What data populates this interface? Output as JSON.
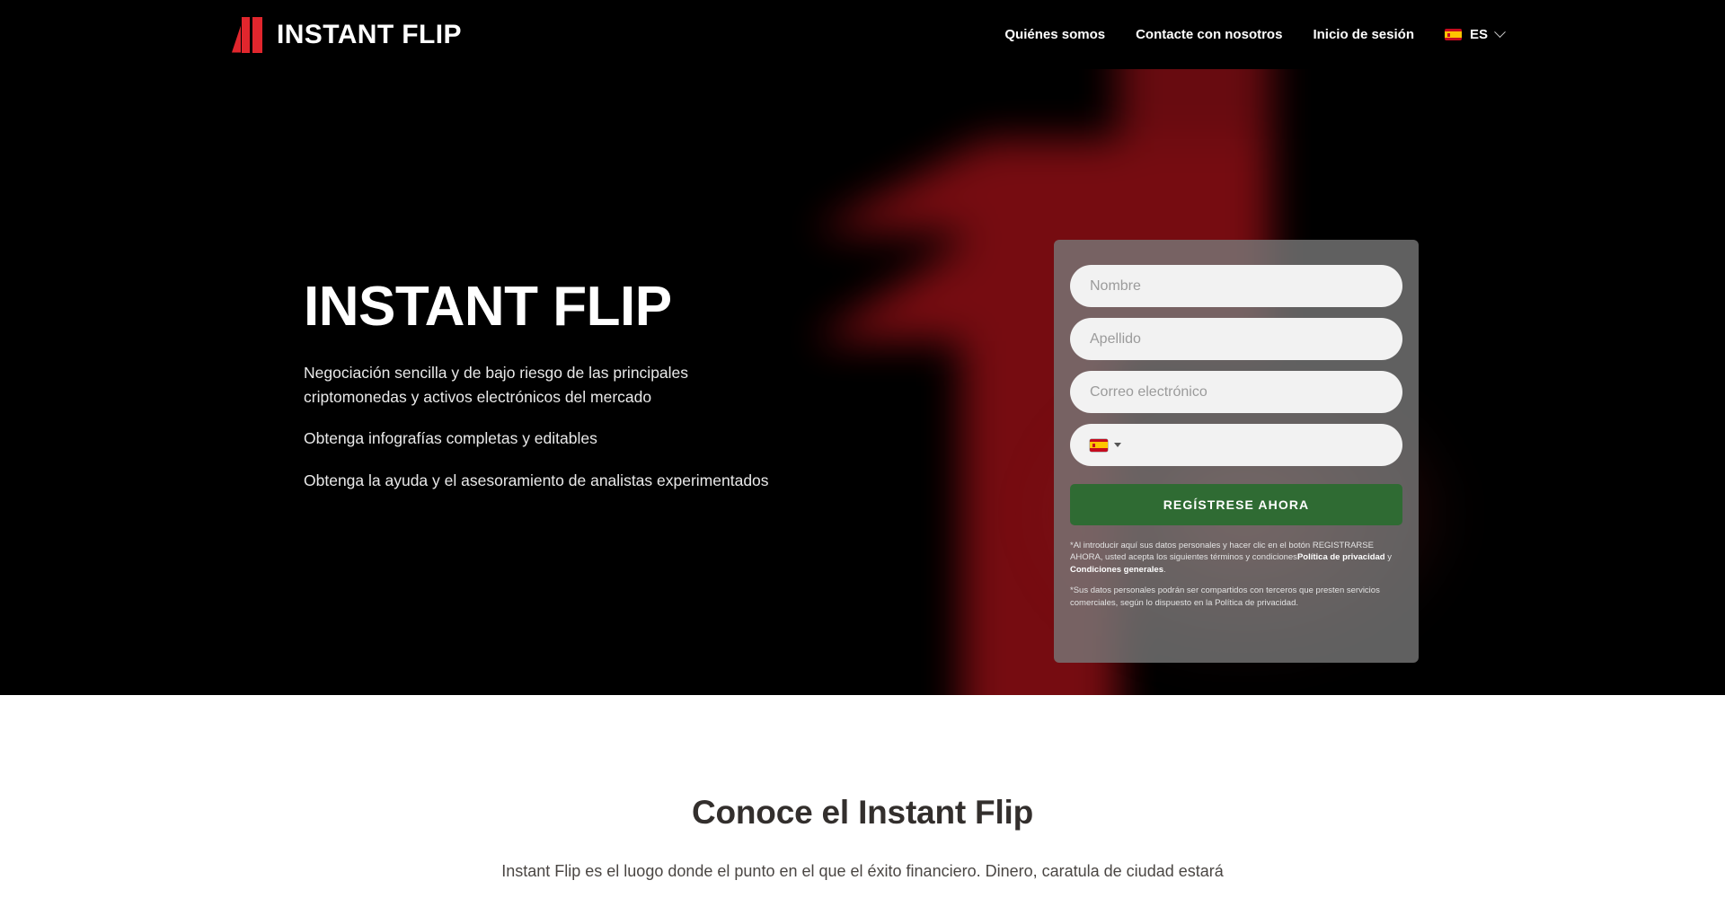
{
  "header": {
    "brand_name": "INSTANT FLIP",
    "logo_icon": "instant-flip-bars-logo",
    "nav": [
      {
        "label": "Quiénes somos"
      },
      {
        "label": "Contacte con nosotros"
      },
      {
        "label": "Inicio de sesión"
      }
    ],
    "language": {
      "code": "ES",
      "flag_icon": "spain-flag-icon",
      "chevron_icon": "chevron-down-icon"
    }
  },
  "hero": {
    "title": "INSTANT FLIP",
    "paragraphs": [
      "Negociación sencilla y de bajo riesgo de las principales criptomonedas y activos electrónicos del mercado",
      "Obtenga infografías completas y editables",
      "Obtenga la ayuda y el asesoramiento de analistas experimentados"
    ],
    "background_icon": "red-up-arrow-graphic"
  },
  "signup": {
    "fields": [
      {
        "name": "first-name",
        "placeholder": "Nombre",
        "value": ""
      },
      {
        "name": "last-name",
        "placeholder": "Apellido",
        "value": ""
      },
      {
        "name": "email",
        "placeholder": "Correo electrónico",
        "value": ""
      }
    ],
    "phone": {
      "flag_icon": "spain-flag-icon",
      "caret_icon": "caret-down-icon",
      "value": ""
    },
    "cta_label": "REGÍSTRESE AHORA",
    "cta_color": "#2f6b33",
    "disclaimer_1_part1": "*Al introducir aquí sus datos personales y hacer clic en el botón REGISTRARSE AHORA, usted acepta los siguientes términos y condiciones",
    "disclaimer_1_link1": "Política de privacidad",
    "disclaimer_1_mid": " y ",
    "disclaimer_1_link2": "Condiciones generales",
    "disclaimer_1_end": ".",
    "disclaimer_2": "*Sus datos personales podrán ser compartidos con terceros que presten servicios comerciales, según lo dispuesto en la Política de privacidad."
  },
  "about": {
    "title": "Conoce el Instant Flip",
    "text": "Instant Flip es el luogo donde el punto en el que el éxito financiero. Dinero, caratula de ciudad estará"
  },
  "colors": {
    "brand_red": "#e1262d",
    "arrow_red": "#7d0d12",
    "header_bg": "#000000",
    "cta_green": "#2f6b33",
    "card_gray": "rgba(120,120,120,.80)"
  }
}
